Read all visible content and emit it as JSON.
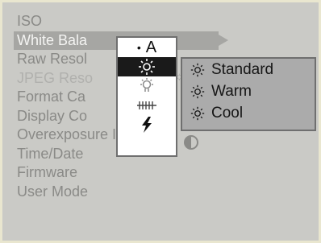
{
  "menu": {
    "items": [
      {
        "label": "ISO"
      },
      {
        "label": "White Bala"
      },
      {
        "label": "Raw Resol"
      },
      {
        "label": "JPEG Reso"
      },
      {
        "label": "Format Ca"
      },
      {
        "label": "Display Co"
      },
      {
        "label": "Overexposure Ind."
      },
      {
        "label": "Time/Date"
      },
      {
        "label": "Firmware"
      },
      {
        "label": "User Mode"
      }
    ]
  },
  "submenu": {
    "auto_label": "A",
    "bullet": "•",
    "icons": [
      "daylight-icon",
      "tungsten-icon",
      "fluorescent-icon",
      "flash-icon"
    ]
  },
  "options": {
    "items": [
      {
        "label": "Standard",
        "icon": "daylight-icon"
      },
      {
        "label": "Warm",
        "icon": "daylight-icon"
      },
      {
        "label": "Cool",
        "icon": "daylight-icon"
      }
    ]
  },
  "colors": {
    "screen_bg": "#cacac6",
    "highlight": "#a6a6a3",
    "selected_bg": "#1a1a1a",
    "panel_bg": "#ababab"
  }
}
